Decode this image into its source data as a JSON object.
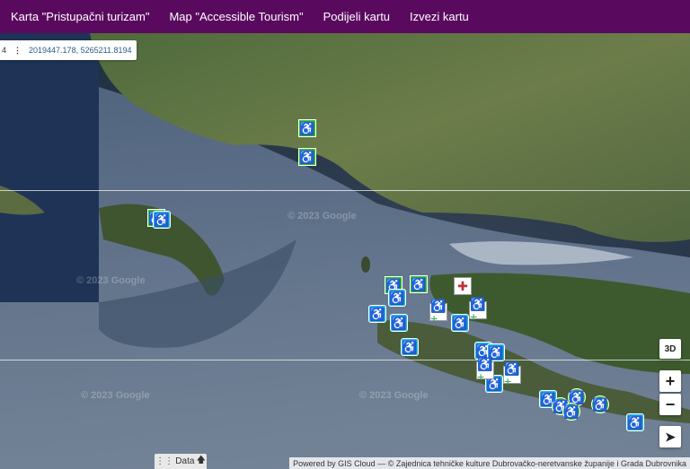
{
  "nav": {
    "items": [
      "Karta \"Pristupačni turizam\"",
      "Map \"Accessible Tourism\"",
      "Podijeli kartu",
      "Izvezi kartu"
    ]
  },
  "coords": {
    "prefix": "4",
    "value": "2019447.178, 5265211.8194"
  },
  "controls": {
    "btn3d": "3D",
    "zoom_in": "+",
    "zoom_out": "−",
    "locate": "➤"
  },
  "data_tab": {
    "label": "Data",
    "grid_icon": "⋮⋮",
    "arrow_icon": "🡅"
  },
  "credit": "Powered by GIS Cloud — © Zajednica tehničke kulture Dubrovačko-neretvanske županije i Grada Dubrovnika",
  "watermarks": [
    "© 2023 Google",
    "© 2023 Google",
    "© 2023 Google",
    "© 2023 Google"
  ],
  "marker_glyphs": {
    "wheelchair": "♿",
    "wheelchair_plus": "♿+",
    "medical": "✚"
  },
  "colors": {
    "nav_bg": "#5a0a5e",
    "marker_green": "#36c21f",
    "marker_cyan": "#29b8e0"
  }
}
